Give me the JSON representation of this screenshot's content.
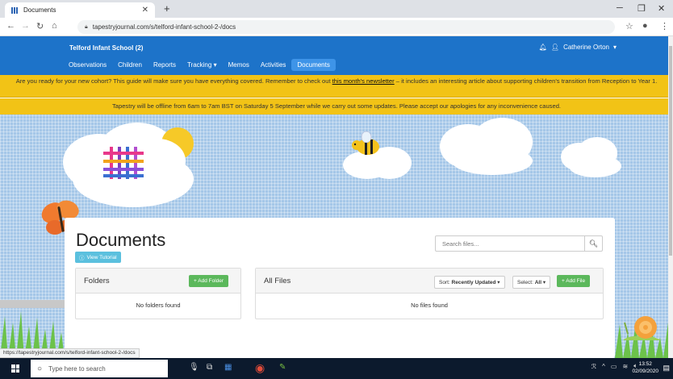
{
  "browser": {
    "tab_title": "Documents",
    "url": "tapestryjournal.com/s/telford-infant-school-2-/docs",
    "status_url": "https://tapestryjournal.com/s/telford-infant-school-2-/docs"
  },
  "app": {
    "school_name": "Telford Infant School (2)",
    "user_name": "Catherine Orton",
    "nav": [
      {
        "label": "Observations",
        "active": false
      },
      {
        "label": "Children",
        "active": false
      },
      {
        "label": "Reports",
        "active": false
      },
      {
        "label": "Tracking",
        "active": false,
        "dropdown": true
      },
      {
        "label": "Memos",
        "active": false
      },
      {
        "label": "Activities",
        "active": false
      },
      {
        "label": "Documents",
        "active": true
      }
    ],
    "alert1": {
      "before": "Are you ready for your new cohort? This guide will make sure you have everything covered. Remember to check out ",
      "link": "this month's newsletter",
      "after": " – it includes an interesting article about supporting children's transition from Reception to Year 1."
    },
    "alert2": "Tapestry will be offline from 6am to 7am BST on Saturday 5 September while we carry out some updates. Please accept our apologies for any inconvenience caused.",
    "colors": {
      "navbar": "#1d73c9",
      "alert": "#f2c316",
      "green": "#5cb85c",
      "info": "#5bc0de"
    }
  },
  "documents": {
    "title": "Documents",
    "tutorial_label": "View Tutorial",
    "search_placeholder": "Search files...",
    "folders": {
      "title": "Folders",
      "add_label": "+ Add Folder",
      "empty": "No folders found"
    },
    "files": {
      "title": "All Files",
      "sort_prefix": "Sort: ",
      "sort_value": "Recently Updated",
      "select_prefix": "Select: ",
      "select_value": "All",
      "add_label": "+ Add File",
      "empty": "No files found"
    }
  },
  "taskbar": {
    "search_placeholder": "Type here to search",
    "time": "13:52",
    "date": "02/09/2020"
  }
}
